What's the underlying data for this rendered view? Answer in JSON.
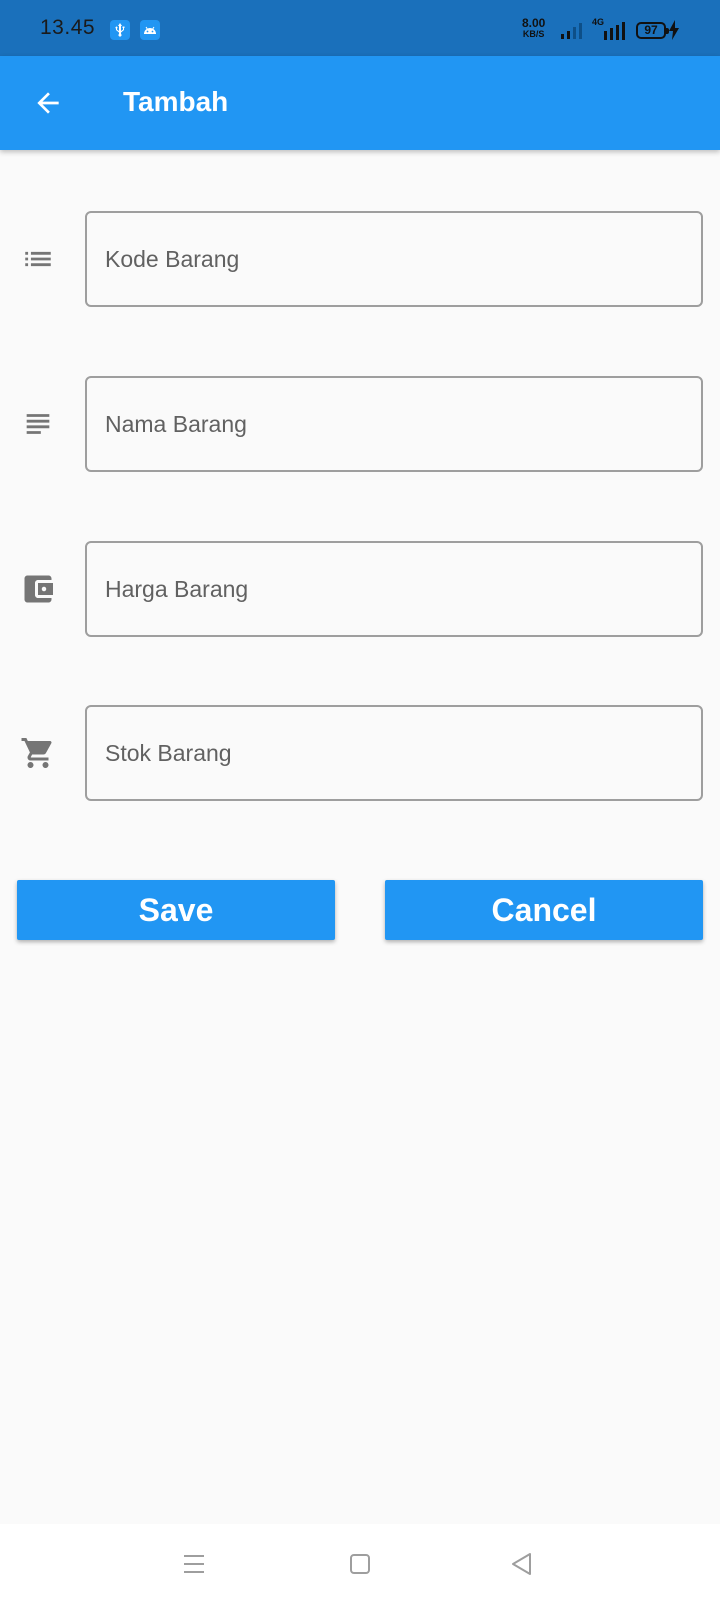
{
  "status_bar": {
    "time": "13.45",
    "net_speed_value": "8.00",
    "net_speed_unit": "KB/S",
    "network_type": "4G",
    "battery_level": "97",
    "icons": [
      "usb-icon",
      "android-icon",
      "signal-icon",
      "signal-4g-icon",
      "battery-icon",
      "charging-icon"
    ]
  },
  "app_bar": {
    "title": "Tambah",
    "background": "#2196f3",
    "back_icon": "arrow-back-icon"
  },
  "form": {
    "fields": [
      {
        "icon": "list-icon",
        "placeholder": "Kode Barang",
        "value": ""
      },
      {
        "icon": "notes-icon",
        "placeholder": "Nama Barang",
        "value": ""
      },
      {
        "icon": "wallet-icon",
        "placeholder": "Harga Barang",
        "value": ""
      },
      {
        "icon": "cart-icon",
        "placeholder": "Stok Barang",
        "value": ""
      }
    ]
  },
  "actions": {
    "save_label": "Save",
    "cancel_label": "Cancel",
    "button_color": "#2196f3"
  },
  "nav_bar": {
    "icons": [
      "menu-icon",
      "home-square-icon",
      "back-triangle-icon"
    ]
  }
}
